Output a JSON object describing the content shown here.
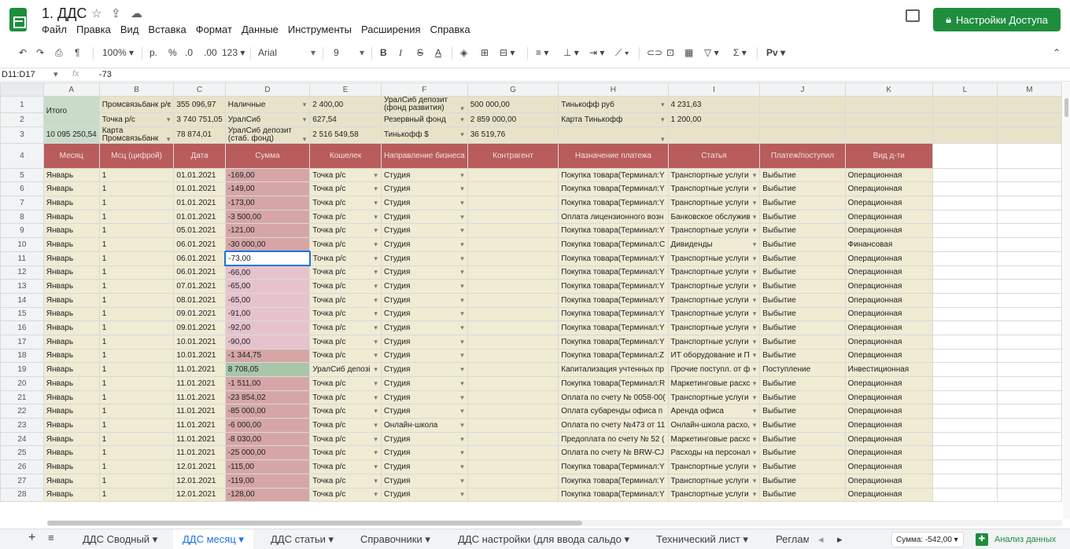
{
  "doc": {
    "title": "1. ДДС"
  },
  "menu": [
    "Файл",
    "Правка",
    "Вид",
    "Вставка",
    "Формат",
    "Данные",
    "Инструменты",
    "Расширения",
    "Справка"
  ],
  "share": {
    "label": "Настройки Доступа"
  },
  "toolbar": {
    "zoom": "100%",
    "currency": "р.",
    "percent": "%",
    "dec_less": ".0",
    "dec_more": ".00",
    "format": "123",
    "font": "Arial",
    "font_size": "9",
    "bold": "B",
    "italic": "I",
    "strike": "S",
    "text_color": "A",
    "script": "Pv"
  },
  "formula_bar": {
    "name_box": "D11:D17",
    "fx": "fx",
    "value": "-73"
  },
  "columns": [
    "A",
    "B",
    "C",
    "D",
    "E",
    "F",
    "G",
    "H",
    "I",
    "J",
    "K",
    "L",
    "M"
  ],
  "summary": {
    "total_label": "Итого",
    "total_value": "10 095 250,54",
    "rows": [
      [
        "Промсвязьбанк р/с",
        "355 096,97",
        "Наличные",
        "2 400,00",
        "УралСиб депозит (фонд развития)",
        "500 000,00",
        "Тинькофф руб",
        "4 231,63"
      ],
      [
        "Точка р/с",
        "3 740 751,05",
        "УралСиб",
        "627,54",
        "Резервный фонд",
        "2 859 000,00",
        "Карта Тинькофф",
        "1 200,00"
      ],
      [
        "Карта Промсвязьбанк",
        "78 874,01",
        "УралСиб депозит (стаб. фонд)",
        "2 516 549,58",
        "Тинькофф $",
        "36 519,76",
        "",
        ""
      ]
    ]
  },
  "headers": [
    "Месяц",
    "Мсц (цифрой)",
    "Дата",
    "Сумма",
    "Кошелек",
    "Направление бизнеса",
    "Контрагент",
    "Назначение платежа",
    "Статья",
    "Платеж/поступил",
    "Вид д-ти"
  ],
  "rows": [
    [
      "5",
      "Январь",
      "1",
      "01.01.2021",
      "-169,00",
      "Точка р/с",
      "Студия",
      "",
      "Покупка товара(Терминал:Y",
      "Транспортные услуги",
      "Выбытие",
      "Операционная"
    ],
    [
      "6",
      "Январь",
      "1",
      "01.01.2021",
      "-149,00",
      "Точка р/с",
      "Студия",
      "",
      "Покупка товара(Терминал:Y",
      "Транспортные услуги",
      "Выбытие",
      "Операционная"
    ],
    [
      "7",
      "Январь",
      "1",
      "01.01.2021",
      "-173,00",
      "Точка р/с",
      "Студия",
      "",
      "Покупка товара(Терминал:Y",
      "Транспортные услуги",
      "Выбытие",
      "Операционная"
    ],
    [
      "8",
      "Январь",
      "1",
      "01.01.2021",
      "-3 500,00",
      "Точка р/с",
      "Студия",
      "",
      "Оплата лицензионного возн",
      "Банковское обслужив",
      "Выбытие",
      "Операционная"
    ],
    [
      "9",
      "Январь",
      "1",
      "05.01.2021",
      "-121,00",
      "Точка р/с",
      "Студия",
      "",
      "Покупка товара(Терминал:Y",
      "Транспортные услуги",
      "Выбытие",
      "Операционная"
    ],
    [
      "10",
      "Январь",
      "1",
      "06.01.2021",
      "-30 000,00",
      "Точка р/с",
      "Студия",
      "",
      "Покупка товара(Терминал:С",
      "Дивиденды",
      "Выбытие",
      "Финансовая"
    ],
    [
      "11",
      "Январь",
      "1",
      "06.01.2021",
      "-73,00",
      "Точка р/с",
      "Студия",
      "",
      "Покупка товара(Терминал:Y",
      "Транспортные услуги",
      "Выбытие",
      "Операционная"
    ],
    [
      "12",
      "Январь",
      "1",
      "06.01.2021",
      "-66,00",
      "Точка р/с",
      "Студия",
      "",
      "Покупка товара(Терминал:Y",
      "Транспортные услуги",
      "Выбытие",
      "Операционная"
    ],
    [
      "13",
      "Январь",
      "1",
      "07.01.2021",
      "-65,00",
      "Точка р/с",
      "Студия",
      "",
      "Покупка товара(Терминал:Y",
      "Транспортные услуги",
      "Выбытие",
      "Операционная"
    ],
    [
      "14",
      "Январь",
      "1",
      "08.01.2021",
      "-65,00",
      "Точка р/с",
      "Студия",
      "",
      "Покупка товара(Терминал:Y",
      "Транспортные услуги",
      "Выбытие",
      "Операционная"
    ],
    [
      "15",
      "Январь",
      "1",
      "09.01.2021",
      "-91,00",
      "Точка р/с",
      "Студия",
      "",
      "Покупка товара(Терминал:Y",
      "Транспортные услуги",
      "Выбытие",
      "Операционная"
    ],
    [
      "16",
      "Январь",
      "1",
      "09.01.2021",
      "-92,00",
      "Точка р/с",
      "Студия",
      "",
      "Покупка товара(Терминал:Y",
      "Транспортные услуги",
      "Выбытие",
      "Операционная"
    ],
    [
      "17",
      "Январь",
      "1",
      "10.01.2021",
      "-90,00",
      "Точка р/с",
      "Студия",
      "",
      "Покупка товара(Терминал:Y",
      "Транспортные услуги",
      "Выбытие",
      "Операционная"
    ],
    [
      "18",
      "Январь",
      "1",
      "10.01.2021",
      "-1 344,75",
      "Точка р/с",
      "Студия",
      "",
      "Покупка товара(Терминал:Z",
      "ИТ оборудование и П",
      "Выбытие",
      "Операционная"
    ],
    [
      "19",
      "Январь",
      "1",
      "11.01.2021",
      "8 708,05",
      "УралСиб депозі",
      "Студия",
      "",
      "Капитализация учтенных пр",
      "Прочие поступл. от ф",
      "Поступление",
      "Инвестиционная"
    ],
    [
      "20",
      "Январь",
      "1",
      "11.01.2021",
      "-1 511,00",
      "Точка р/с",
      "Студия",
      "",
      "Покупка товара(Терминал:R",
      "Маркетинговые расхс",
      "Выбытие",
      "Операционная"
    ],
    [
      "21",
      "Январь",
      "1",
      "11.01.2021",
      "-23 854,02",
      "Точка р/с",
      "Студия",
      "",
      "Оплата по счету № 0058-00(",
      "Транспортные услуги",
      "Выбытие",
      "Операционная"
    ],
    [
      "22",
      "Январь",
      "1",
      "11.01.2021",
      "-85 000,00",
      "Точка р/с",
      "Студия",
      "",
      "Оплата субаренды офиса п",
      "Аренда офиса",
      "Выбытие",
      "Операционная"
    ],
    [
      "23",
      "Январь",
      "1",
      "11.01.2021",
      "-6 000,00",
      "Точка р/с",
      "Онлайн-школа",
      "",
      "Оплата по счету №473 от 11",
      "Онлайн-школа расхо,",
      "Выбытие",
      "Операционная"
    ],
    [
      "24",
      "Январь",
      "1",
      "11.01.2021",
      "-8 030,00",
      "Точка р/с",
      "Студия",
      "",
      "Предоплата по счету № 52 (",
      "Маркетинговые расхс",
      "Выбытие",
      "Операционная"
    ],
    [
      "25",
      "Январь",
      "1",
      "11.01.2021",
      "-25 000,00",
      "Точка р/с",
      "Студия",
      "",
      "Оплата по счету № BRW-CJ",
      "Расходы на персонал",
      "Выбытие",
      "Операционная"
    ],
    [
      "26",
      "Январь",
      "1",
      "12.01.2021",
      "-115,00",
      "Точка р/с",
      "Студия",
      "",
      "Покупка товара(Терминал:Y",
      "Транспортные услуги",
      "Выбытие",
      "Операционная"
    ],
    [
      "27",
      "Январь",
      "1",
      "12.01.2021",
      "-119,00",
      "Точка р/с",
      "Студия",
      "",
      "Покупка товара(Терминал:Y",
      "Транспортные услуги",
      "Выбытие",
      "Операционная"
    ],
    [
      "28",
      "Январь",
      "1",
      "12.01.2021",
      "-128,00",
      "Точка р/с",
      "Студия",
      "",
      "Покупка товара(Терминал:Y",
      "Транспортные услуги",
      "Выбытие",
      "Операционная"
    ]
  ],
  "sheets": [
    "ДДС Сводный",
    "ДДС месяц",
    "ДДС статьи",
    "Справочники",
    "ДДС настройки (для ввода сальдо",
    "Технический лист",
    "Реглам"
  ],
  "status": {
    "sum": "Сумма: -542,00",
    "explore": "Анализ данных"
  }
}
